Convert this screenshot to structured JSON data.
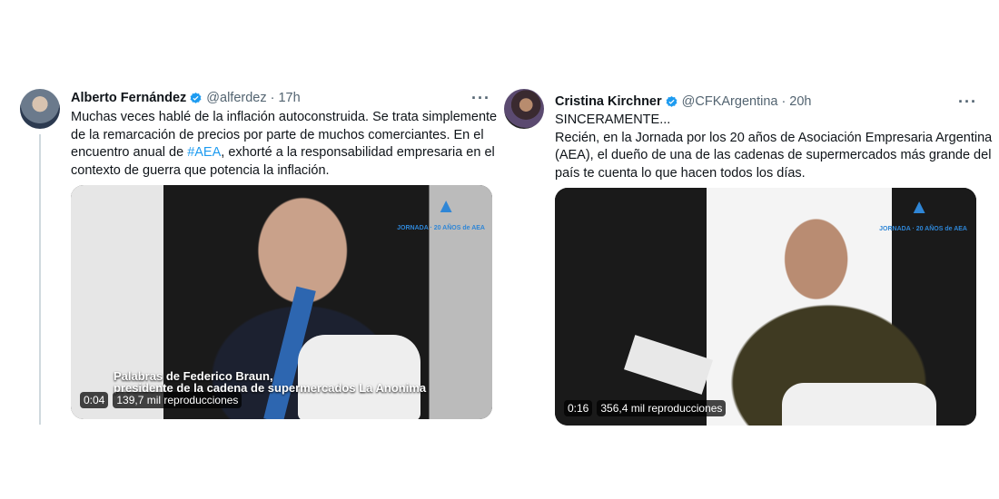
{
  "tweets": [
    {
      "name": "Alberto Fernández",
      "handle": "@alferdez",
      "time": "17h",
      "text_lines": [
        "Muchas veces hablé de la inflación autoconstruida. Se trata simplemente",
        "de la remarcación de precios por parte de muchos comerciantes. En el",
        [
          "encuentro anual de ",
          "#AEA",
          ", exhorté a la responsabilidad empresaria en el"
        ],
        "contexto de guerra que potencia la inflación."
      ],
      "video": {
        "caption_line1": "Palabras de Federico Braun,",
        "caption_line2": "presidente de la cadena de supermercados La Anonima",
        "duration": "0:04",
        "views": "139,7 mil reproducciones",
        "logo_sub": "JORNADA · 20 AÑOS de AEA"
      }
    },
    {
      "name": "Cristina Kirchner",
      "handle": "@CFKArgentina",
      "time": "20h",
      "text_lines": [
        "SINCERAMENTE...",
        "Recién, en la Jornada por los 20 años de Asociación Empresaria Argentina",
        "(AEA), el dueño de una de las cadenas de supermercados más grande del",
        "país te cuenta lo que hacen todos los días."
      ],
      "video": {
        "duration": "0:16",
        "views": "356,4 mil reproducciones",
        "logo_sub": "JORNADA · 20 AÑOS de AEA"
      }
    }
  ],
  "more_label": "···",
  "colors": {
    "link": "#1d9bf0",
    "verified": "#1d9bf0",
    "secondary": "#536471"
  },
  "icons": [
    "verified-badge-icon",
    "more-options-icon"
  ]
}
